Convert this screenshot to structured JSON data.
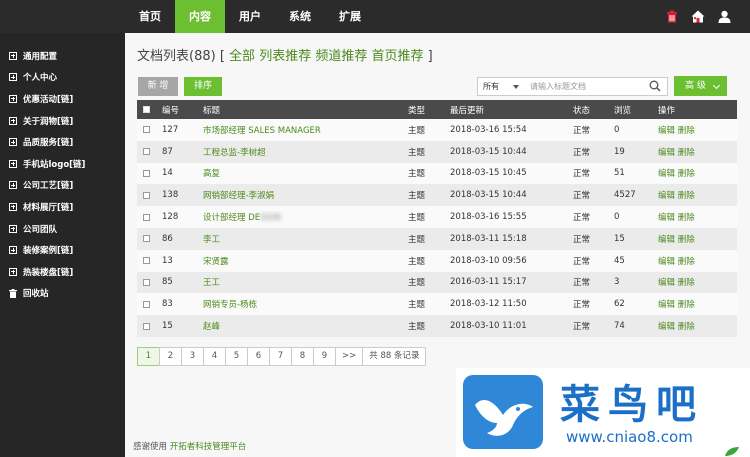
{
  "topnav": {
    "items": [
      {
        "label": "首页",
        "active": false
      },
      {
        "label": "内容",
        "active": true
      },
      {
        "label": "用户",
        "active": false
      },
      {
        "label": "系统",
        "active": false
      },
      {
        "label": "扩展",
        "active": false
      }
    ],
    "icons": [
      "trash-icon",
      "home-icon",
      "user-icon"
    ]
  },
  "sidebar": {
    "items": [
      {
        "label": "通用配置",
        "icon": "plus-box-icon"
      },
      {
        "label": "个人中心",
        "icon": "plus-box-icon"
      },
      {
        "label": "优惠活动[链]",
        "icon": "plus-box-icon"
      },
      {
        "label": "关于润物[链]",
        "icon": "plus-box-icon"
      },
      {
        "label": "品质服务[链]",
        "icon": "plus-box-icon"
      },
      {
        "label": "手机站logo[链]",
        "icon": "plus-box-icon"
      },
      {
        "label": "公司工艺[链]",
        "icon": "plus-box-icon"
      },
      {
        "label": "材料展厅[链]",
        "icon": "plus-box-icon"
      },
      {
        "label": "公司团队",
        "icon": "plus-box-icon"
      },
      {
        "label": "装修案例[链]",
        "icon": "plus-box-icon"
      },
      {
        "label": "热装楼盘[链]",
        "icon": "plus-box-icon"
      },
      {
        "label": "回收站",
        "icon": "trash-icon"
      }
    ]
  },
  "main": {
    "heading": {
      "prefix": "文档列表(88) [",
      "links": [
        "全部",
        "列表推荐",
        "频道推荐",
        "首页推荐"
      ],
      "suffix": "]"
    },
    "toolbar": {
      "new_label": "新 增",
      "sort_label": "排序",
      "filter_selected": "所有",
      "search_placeholder": "请输入标题文档",
      "advanced_label": "高 级"
    },
    "table": {
      "headers": [
        "编号",
        "标题",
        "类型",
        "最后更新",
        "状态",
        "浏览",
        "操作"
      ],
      "edit_label": "编辑",
      "delete_label": "删除",
      "rows": [
        {
          "id": "127",
          "title": "市场部经理 SALES MANAGER",
          "type": "主题",
          "updated": "2018-03-16 15:54",
          "status": "正常",
          "views": "0",
          "blur": false
        },
        {
          "id": "87",
          "title": "工程总监-李树超",
          "type": "主题",
          "updated": "2018-03-15 10:44",
          "status": "正常",
          "views": "19",
          "blur": false
        },
        {
          "id": "14",
          "title": "高复",
          "type": "主题",
          "updated": "2018-03-15 10:45",
          "status": "正常",
          "views": "51",
          "blur": false
        },
        {
          "id": "138",
          "title": "网销部经理-李淑娟",
          "type": "主题",
          "updated": "2018-03-15 10:44",
          "status": "正常",
          "views": "4527",
          "blur": false
        },
        {
          "id": "128",
          "title": "设计部经理 DESIGN",
          "type": "主题",
          "updated": "2018-03-16 15:55",
          "status": "正常",
          "views": "0",
          "blur": true
        },
        {
          "id": "86",
          "title": "李工",
          "type": "主题",
          "updated": "2018-03-11 15:18",
          "status": "正常",
          "views": "15",
          "blur": false
        },
        {
          "id": "13",
          "title": "宋贤露",
          "type": "主题",
          "updated": "2018-03-10 09:56",
          "status": "正常",
          "views": "45",
          "blur": false
        },
        {
          "id": "85",
          "title": "王工",
          "type": "主题",
          "updated": "2016-03-11 15:17",
          "status": "正常",
          "views": "3",
          "blur": false
        },
        {
          "id": "83",
          "title": "网销专员-杨栋",
          "type": "主题",
          "updated": "2018-03-12 11:50",
          "status": "正常",
          "views": "62",
          "blur": false
        },
        {
          "id": "15",
          "title": "赵峰",
          "type": "主题",
          "updated": "2018-03-10 11:01",
          "status": "正常",
          "views": "74",
          "blur": false
        }
      ]
    },
    "pagination": {
      "pages": [
        "1",
        "2",
        "3",
        "4",
        "5",
        "6",
        "7",
        "8",
        "9"
      ],
      "current": "1",
      "next_label": ">>",
      "total_label": "共 88 条记录"
    },
    "footer": {
      "prefix": "感谢使用",
      "link": "开拓者科技管理平台"
    }
  },
  "watermark": {
    "text": "菜鸟吧",
    "url": "www.cniao8.com"
  },
  "colors": {
    "accent": "#6bbf31",
    "link": "#4c8a1e",
    "topbar": "#2b2b2b",
    "sidebar": "#262626",
    "table_header": "#4a4a4a",
    "watermark": "#1b6fc6"
  }
}
